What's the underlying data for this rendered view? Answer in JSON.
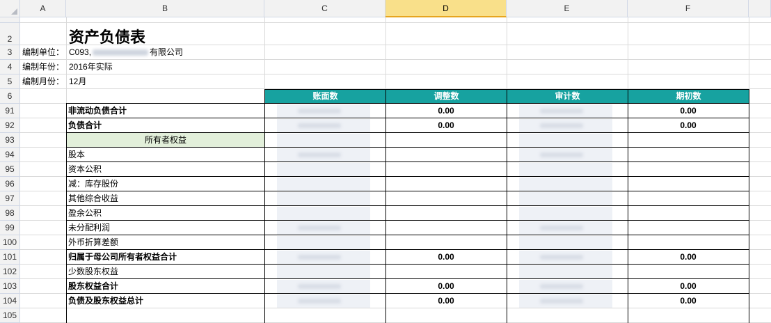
{
  "sheet": {
    "columns": [
      "A",
      "B",
      "C",
      "D",
      "E",
      "F"
    ],
    "selected_column": "D",
    "title": "资产负债表",
    "info_rows": [
      {
        "row": "3",
        "label": "编制单位：",
        "value_prefix": "C093,",
        "value_suffix": "有限公司"
      },
      {
        "row": "4",
        "label": "编制年份：",
        "value": "2016年实际"
      },
      {
        "row": "5",
        "label": "编制月份：",
        "value": "12月"
      }
    ],
    "table_headers": [
      "账面数",
      "调整数",
      "审计数",
      "期初数"
    ],
    "rows": [
      {
        "row": "91",
        "label": "非流动负债合计",
        "bold": true,
        "adj": "0.00",
        "open": "0.00",
        "book": true,
        "audit": true
      },
      {
        "row": "92",
        "label": "负债合计",
        "bold": true,
        "adj": "0.00",
        "open": "0.00",
        "book": true,
        "audit": true
      },
      {
        "row": "93",
        "label": "所有者权益",
        "section": true
      },
      {
        "row": "94",
        "label": "股本",
        "book": true,
        "audit": true
      },
      {
        "row": "95",
        "label": "资本公积"
      },
      {
        "row": "96",
        "label": "减：库存股份"
      },
      {
        "row": "97",
        "label": "其他综合收益"
      },
      {
        "row": "98",
        "label": "盈余公积"
      },
      {
        "row": "99",
        "label": "未分配利润",
        "book": true,
        "audit": true
      },
      {
        "row": "100",
        "label": "外币折算差额"
      },
      {
        "row": "101",
        "label": "归属于母公司所有者权益合计",
        "bold": true,
        "adj": "0.00",
        "open": "0.00",
        "book": true,
        "audit": true
      },
      {
        "row": "102",
        "label": "少数股东权益"
      },
      {
        "row": "103",
        "label": "股东权益合计",
        "bold": true,
        "adj": "0.00",
        "open": "0.00",
        "book": true,
        "audit": true
      },
      {
        "row": "104",
        "label": "负债及股东权益总计",
        "bold": true,
        "adj": "0.00",
        "open": "0.00",
        "book": true,
        "audit": true
      },
      {
        "row": "105",
        "label": ""
      }
    ],
    "colors": {
      "header_fill": "#17a2a0",
      "section_fill": "#e2efda",
      "selected_col": "#f9e08a"
    }
  }
}
